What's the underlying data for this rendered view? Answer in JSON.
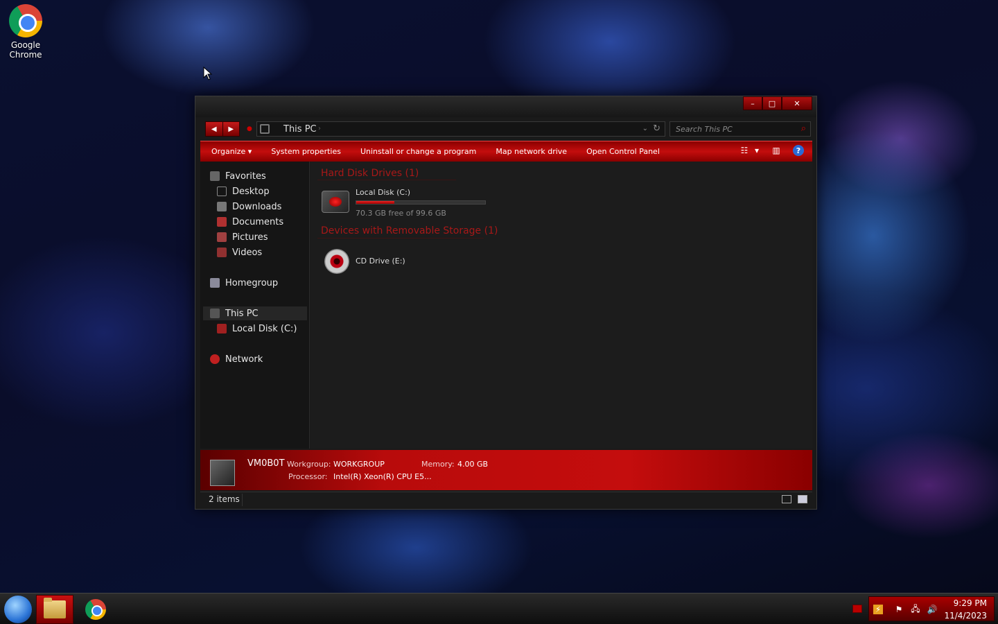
{
  "desktop": {
    "icons": [
      {
        "label_line1": "Google",
        "label_line2": "Chrome",
        "icon": "chrome-icon"
      }
    ]
  },
  "window": {
    "caption": {
      "minimize": "–",
      "maximize": "□",
      "close": "✕"
    },
    "nav": {
      "back": "◀",
      "forward": "▶"
    },
    "address": {
      "crumb": "This PC",
      "separator": "›",
      "dropdown": "⌄",
      "refresh": "↻"
    },
    "search": {
      "placeholder": "Search This PC",
      "icon": "⌕"
    },
    "commands": {
      "organize": "Organize ▾",
      "system_properties": "System properties",
      "uninstall": "Uninstall or change a program",
      "map_drive": "Map network drive",
      "control_panel": "Open Control Panel"
    },
    "toolbar_icons": {
      "view_options": "☷",
      "view_dropdown": "▾",
      "preview_pane": "▥",
      "help": "?"
    },
    "nav_pane": {
      "favorites": "Favorites",
      "desktop": "Desktop",
      "downloads": "Downloads",
      "documents": "Documents",
      "pictures": "Pictures",
      "videos": "Videos",
      "homegroup": "Homegroup",
      "this_pc": "This PC",
      "local_disk": "Local Disk (C:)",
      "network": "Network"
    },
    "content": {
      "group_hdd": "Hard Disk Drives (1)",
      "group_removable": "Devices with Removable Storage (1)",
      "drives": [
        {
          "name": "Local Disk (C:)",
          "free_text": "70.3 GB free of 99.6 GB",
          "used_fraction": 0.294
        }
      ],
      "removable": [
        {
          "name": "CD Drive (E:)"
        }
      ]
    },
    "details": {
      "computer_name": "VM0B0T",
      "workgroup_label": "Workgroup:",
      "workgroup_value": "WORKGROUP",
      "memory_label": "Memory:",
      "memory_value": "4.00 GB",
      "processor_label": "Processor:",
      "processor_value": "Intel(R) Xeon(R) CPU E5..."
    },
    "status": {
      "item_count": "2 items"
    }
  },
  "taskbar": {
    "clock_time": "9:29 PM",
    "clock_date": "11/4/2023",
    "tray_icons": {
      "power": "⚡",
      "flag": "⚑",
      "network": "🖧",
      "volume": "🔊"
    }
  },
  "colors": {
    "accent": "#c40d0d",
    "group_header": "#a81818",
    "background": "#1c1c1c"
  }
}
